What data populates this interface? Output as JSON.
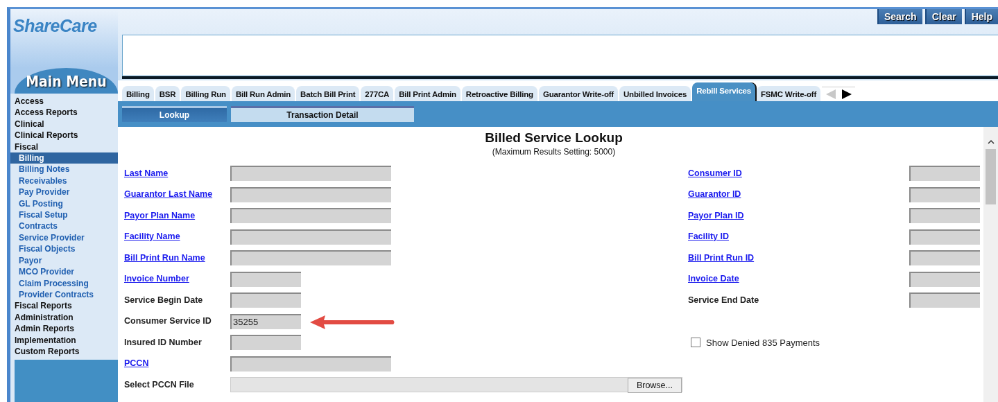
{
  "header": {
    "logo": "ShareCare",
    "buttons": [
      "Search",
      "Clear",
      "Help"
    ]
  },
  "sidebar": {
    "title": "Main Menu",
    "items": [
      {
        "label": "Access",
        "selected": false
      },
      {
        "label": "Access Reports",
        "selected": false
      },
      {
        "label": "Clinical",
        "selected": false
      },
      {
        "label": "Clinical Reports",
        "selected": false
      },
      {
        "label": "Fiscal",
        "selected": false,
        "children": [
          {
            "label": "Billing",
            "selected": true
          },
          {
            "label": "Billing Notes",
            "selected": false
          },
          {
            "label": "Receivables",
            "selected": false
          },
          {
            "label": "Pay Provider",
            "selected": false
          },
          {
            "label": "GL Posting",
            "selected": false
          },
          {
            "label": "Fiscal Setup",
            "selected": false
          },
          {
            "label": "Contracts",
            "selected": false
          },
          {
            "label": "Service Provider",
            "selected": false
          },
          {
            "label": "Fiscal Objects",
            "selected": false
          },
          {
            "label": "Payor",
            "selected": false
          },
          {
            "label": "MCO Provider",
            "selected": false
          },
          {
            "label": "Claim Processing",
            "selected": false
          },
          {
            "label": "Provider Contracts",
            "selected": false
          }
        ]
      },
      {
        "label": "Fiscal Reports",
        "selected": false
      },
      {
        "label": "Administration",
        "selected": false
      },
      {
        "label": "Admin Reports",
        "selected": false
      },
      {
        "label": "Implementation",
        "selected": false
      },
      {
        "label": "Custom Reports",
        "selected": false
      }
    ]
  },
  "tabs": [
    {
      "label": "Billing",
      "selected": false
    },
    {
      "label": "BSR",
      "selected": false
    },
    {
      "label": "Billing Run",
      "selected": false
    },
    {
      "label": "Bill Run Admin",
      "selected": false
    },
    {
      "label": "Batch Bill Print",
      "selected": false
    },
    {
      "label": "277CA",
      "selected": false
    },
    {
      "label": "Bill Print Admin",
      "selected": false
    },
    {
      "label": "Retroactive Billing",
      "selected": false
    },
    {
      "label": "Guarantor Write-off",
      "selected": false
    },
    {
      "label": "Unbilled Invoices",
      "selected": false
    },
    {
      "label": "Rebill Services",
      "selected": true
    },
    {
      "label": "FSMC Write-off",
      "selected": false
    }
  ],
  "subtabs": [
    {
      "label": "Lookup",
      "selected": true
    },
    {
      "label": "Transaction Detail",
      "selected": false
    }
  ],
  "form": {
    "title": "Billed Service Lookup",
    "subtitle": "(Maximum Results Setting: 5000)",
    "left_fields": [
      {
        "label": "Last Name",
        "kind": "link"
      },
      {
        "label": "Guarantor Last Name",
        "kind": "link"
      },
      {
        "label": "Payor Plan Name",
        "kind": "link"
      },
      {
        "label": "Facility Name",
        "kind": "link"
      },
      {
        "label": "Bill Print Run Name",
        "kind": "link"
      },
      {
        "label": "Invoice Number",
        "kind": "link"
      },
      {
        "label": "Service Begin Date",
        "kind": "text"
      },
      {
        "label": "Consumer Service ID",
        "kind": "text",
        "value": "35255"
      },
      {
        "label": "Insured ID Number",
        "kind": "text"
      },
      {
        "label": "PCCN",
        "kind": "link"
      }
    ],
    "right_fields": [
      {
        "label": "Consumer ID",
        "kind": "link"
      },
      {
        "label": "Guarantor ID",
        "kind": "link"
      },
      {
        "label": "Payor Plan ID",
        "kind": "link"
      },
      {
        "label": "Facility ID",
        "kind": "link"
      },
      {
        "label": "Bill Print Run ID",
        "kind": "link"
      },
      {
        "label": "Invoice Date",
        "kind": "link"
      },
      {
        "label": "Service End Date",
        "kind": "text"
      }
    ],
    "checkbox": {
      "label": "Show Denied 835 Payments",
      "checked": false
    },
    "file": {
      "label": "Select PCCN File",
      "button": "Browse..."
    }
  }
}
